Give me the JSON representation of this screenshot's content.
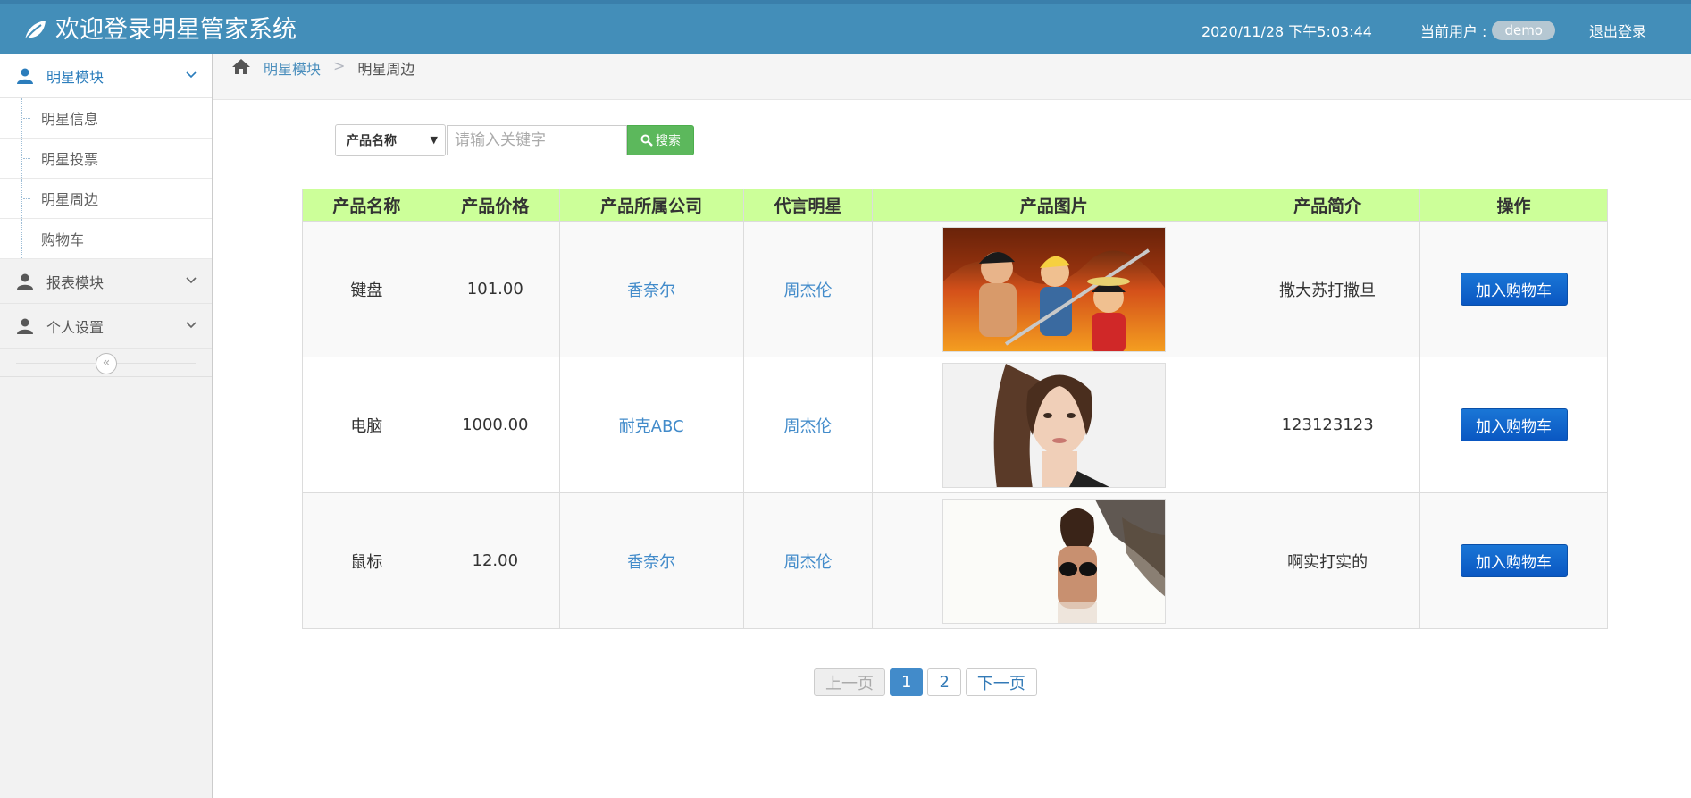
{
  "header": {
    "title": "欢迎登录明星管家系统",
    "datetime": "2020/11/28 下午5:03:44",
    "current_user_label": "当前用户 :",
    "username": "demo",
    "logout_label": "退出登录"
  },
  "sidebar": {
    "modules": [
      {
        "label": "明星模块",
        "items": [
          "明星信息",
          "明星投票",
          "明星周边",
          "购物车"
        ]
      },
      {
        "label": "报表模块"
      },
      {
        "label": "个人设置"
      }
    ],
    "collapse_glyph": "«"
  },
  "breadcrumb": {
    "parent": "明星模块",
    "separator": ">",
    "current": "明星周边"
  },
  "search": {
    "select_value": "产品名称",
    "placeholder": "请输入关键字",
    "button_label": "搜索"
  },
  "table": {
    "headers": [
      "产品名称",
      "产品价格",
      "产品所属公司",
      "代言明星",
      "产品图片",
      "产品简介",
      "操作"
    ],
    "rows": [
      {
        "name": "键盘",
        "price": "101.00",
        "company": "香奈尔",
        "star": "周杰伦",
        "intro": "撒大苏打撒旦",
        "action": "加入购物车"
      },
      {
        "name": "电脑",
        "price": "1000.00",
        "company": "耐克ABC",
        "star": "周杰伦",
        "intro": "123123123",
        "action": "加入购物车"
      },
      {
        "name": "鼠标",
        "price": "12.00",
        "company": "香奈尔",
        "star": "周杰伦",
        "intro": "啊实打实的",
        "action": "加入购物车"
      }
    ]
  },
  "pagination": {
    "prev": "上一页",
    "pages": [
      "1",
      "2"
    ],
    "current": "1",
    "next": "下一页"
  },
  "colors": {
    "header_bg": "#438eb9",
    "table_header_bg": "#ccff99",
    "search_button": "#5cb85c",
    "cart_button": "#0a57c2",
    "link": "#428bca"
  }
}
